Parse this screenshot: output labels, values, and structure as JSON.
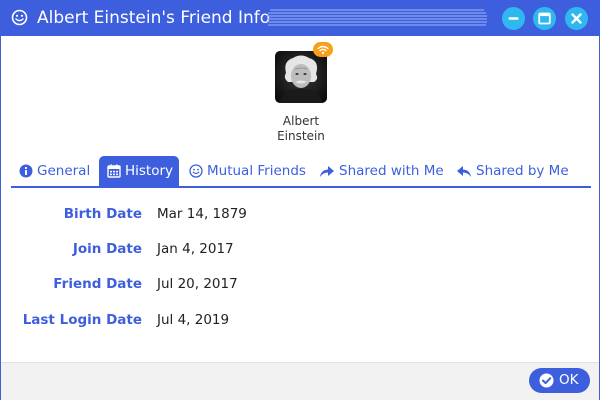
{
  "window": {
    "title": "Albert Einstein's Friend Info",
    "title_icon": "smiley-icon",
    "controls": {
      "minimize_icon": "minimize-icon",
      "maximize_icon": "maximize-icon",
      "close_icon": "close-icon"
    }
  },
  "profile": {
    "name_first": "Albert",
    "name_last": "Einstein",
    "status_icon": "wifi-icon",
    "status_color": "#f7a11a"
  },
  "tabs": [
    {
      "label": "General",
      "icon": "info-icon",
      "active": false
    },
    {
      "label": "History",
      "icon": "calendar-icon",
      "active": true
    },
    {
      "label": "Mutual Friends",
      "icon": "smiley-icon",
      "active": false
    },
    {
      "label": "Shared with Me",
      "icon": "share-icon",
      "active": false
    },
    {
      "label": "Shared by Me",
      "icon": "reply-icon",
      "active": false
    }
  ],
  "history": [
    {
      "label": "Birth Date",
      "value": "Mar 14, 1879"
    },
    {
      "label": "Join Date",
      "value": "Jan 4, 2017"
    },
    {
      "label": "Friend Date",
      "value": "Jul 20, 2017"
    },
    {
      "label": "Last Login Date",
      "value": "Jul 4, 2019"
    }
  ],
  "footer": {
    "ok_label": "OK",
    "ok_icon": "check-icon"
  },
  "colors": {
    "accent": "#3d5fdd",
    "window_button": "#2fb8f0",
    "footer_bg": "#f2f2f2"
  }
}
